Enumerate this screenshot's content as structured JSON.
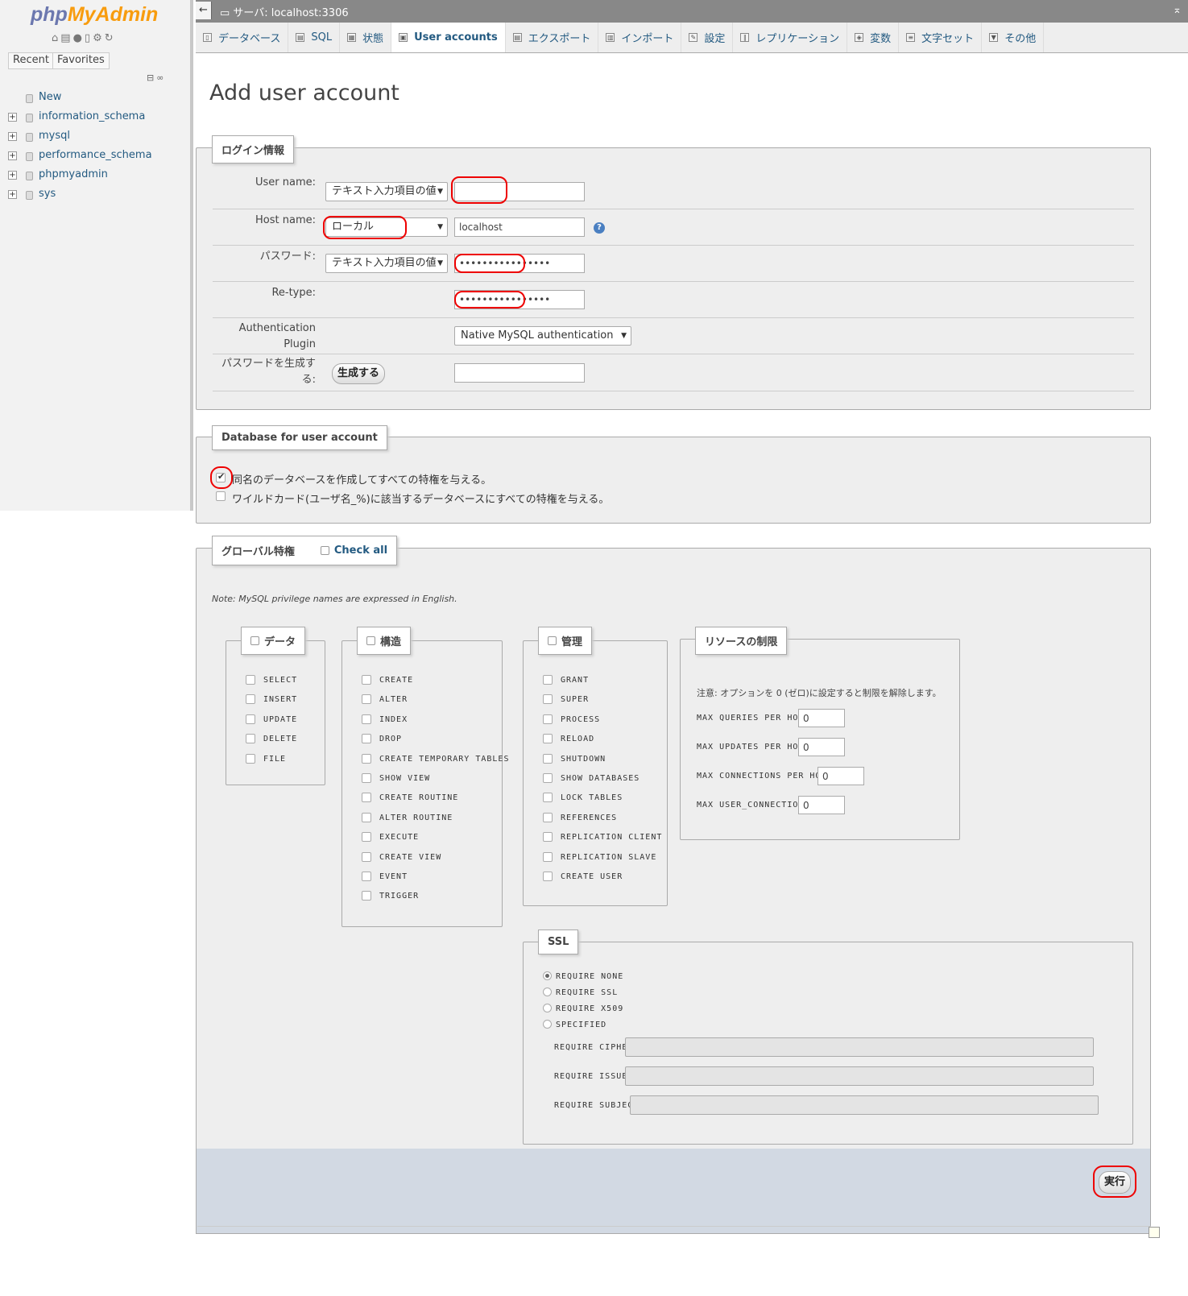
{
  "sidebar": {
    "logo_php": "php",
    "logo_myadmin": "MyAdmin",
    "quick_icons": [
      "home-icon",
      "exit-icon",
      "help-icon",
      "docs-icon",
      "settings-icon",
      "reload-icon"
    ],
    "recent_label": "Recent",
    "favorites_label": "Favorites",
    "tree": [
      {
        "label": "New",
        "expandable": false
      },
      {
        "label": "information_schema",
        "expandable": true
      },
      {
        "label": "mysql",
        "expandable": true
      },
      {
        "label": "performance_schema",
        "expandable": true
      },
      {
        "label": "phpmyadmin",
        "expandable": true
      },
      {
        "label": "sys",
        "expandable": true
      }
    ]
  },
  "topbar": {
    "server_title": "サーバ: localhost:3306"
  },
  "tabs": [
    {
      "label": "データベース",
      "icon": "database-icon",
      "active": false
    },
    {
      "label": "SQL",
      "icon": "sql-icon",
      "active": false
    },
    {
      "label": "状態",
      "icon": "status-icon",
      "active": false
    },
    {
      "label": "User accounts",
      "icon": "users-icon",
      "active": true
    },
    {
      "label": "エクスポート",
      "icon": "export-icon",
      "active": false
    },
    {
      "label": "インポート",
      "icon": "import-icon",
      "active": false
    },
    {
      "label": "設定",
      "icon": "settings-icon",
      "active": false
    },
    {
      "label": "レプリケーション",
      "icon": "replication-icon",
      "active": false
    },
    {
      "label": "変数",
      "icon": "variables-icon",
      "active": false
    },
    {
      "label": "文字セット",
      "icon": "charset-icon",
      "active": false
    },
    {
      "label": "その他",
      "icon": "more-icon",
      "active": false
    }
  ],
  "page_title": "Add user account",
  "login": {
    "legend": "ログイン情報",
    "username_label": "User name:",
    "username_type": "テキスト入力項目の値",
    "username_value": "",
    "hostname_label": "Host name:",
    "hostname_type": "ローカル",
    "hostname_value": "localhost",
    "password_label": "パスワード:",
    "password_type": "テキスト入力項目の値",
    "password_value": "••••••••••••••••",
    "retype_label": "Re-type:",
    "retype_value": "••••••••••••••••",
    "auth_label_1": "Authentication",
    "auth_label_2": "Plugin",
    "auth_value": "Native MySQL authentication",
    "generate_label_1": "パスワードを生成す",
    "generate_label_2": "る:",
    "generate_button": "生成する",
    "generate_value": ""
  },
  "database": {
    "legend": "Database for user account",
    "option1": "同名のデータベースを作成してすべての特権を与える。",
    "option1_checked": true,
    "option2": "ワイルドカード(ユーザ名_%)に該当するデータベースにすべての特権を与える。",
    "option2_checked": false
  },
  "global": {
    "legend": "グローバル特権",
    "check_all": "Check all",
    "note": "Note: MySQL privilege names are expressed in English.",
    "data": {
      "legend": "データ",
      "items": [
        "SELECT",
        "INSERT",
        "UPDATE",
        "DELETE",
        "FILE"
      ]
    },
    "structure": {
      "legend": "構造",
      "items": [
        "CREATE",
        "ALTER",
        "INDEX",
        "DROP",
        "CREATE TEMPORARY TABLES",
        "SHOW VIEW",
        "CREATE ROUTINE",
        "ALTER ROUTINE",
        "EXECUTE",
        "CREATE VIEW",
        "EVENT",
        "TRIGGER"
      ]
    },
    "admin": {
      "legend": "管理",
      "items": [
        "GRANT",
        "SUPER",
        "PROCESS",
        "RELOAD",
        "SHUTDOWN",
        "SHOW DATABASES",
        "LOCK TABLES",
        "REFERENCES",
        "REPLICATION CLIENT",
        "REPLICATION SLAVE",
        "CREATE USER"
      ]
    },
    "resources": {
      "legend": "リソースの制限",
      "note": "注意: オプションを 0 (ゼロ)に設定すると制限を解除します。",
      "items": [
        {
          "label": "MAX QUERIES PER HOUR",
          "value": "0"
        },
        {
          "label": "MAX UPDATES PER HOUR",
          "value": "0"
        },
        {
          "label": "MAX CONNECTIONS PER HOUR",
          "value": "0"
        },
        {
          "label": "MAX USER_CONNECTIONS",
          "value": "0"
        }
      ]
    },
    "ssl": {
      "legend": "SSL",
      "options": [
        "REQUIRE NONE",
        "REQUIRE SSL",
        "REQUIRE X509",
        "SPECIFIED"
      ],
      "selected": "REQUIRE NONE",
      "fields": [
        "REQUIRE CIPHER",
        "REQUIRE ISSUER",
        "REQUIRE SUBJECT"
      ]
    }
  },
  "submit_button": "実行",
  "colors": {
    "link": "#235a81",
    "highlight": "#ee0000",
    "panel": "#eeeeee",
    "footer": "#d2d9e3"
  }
}
